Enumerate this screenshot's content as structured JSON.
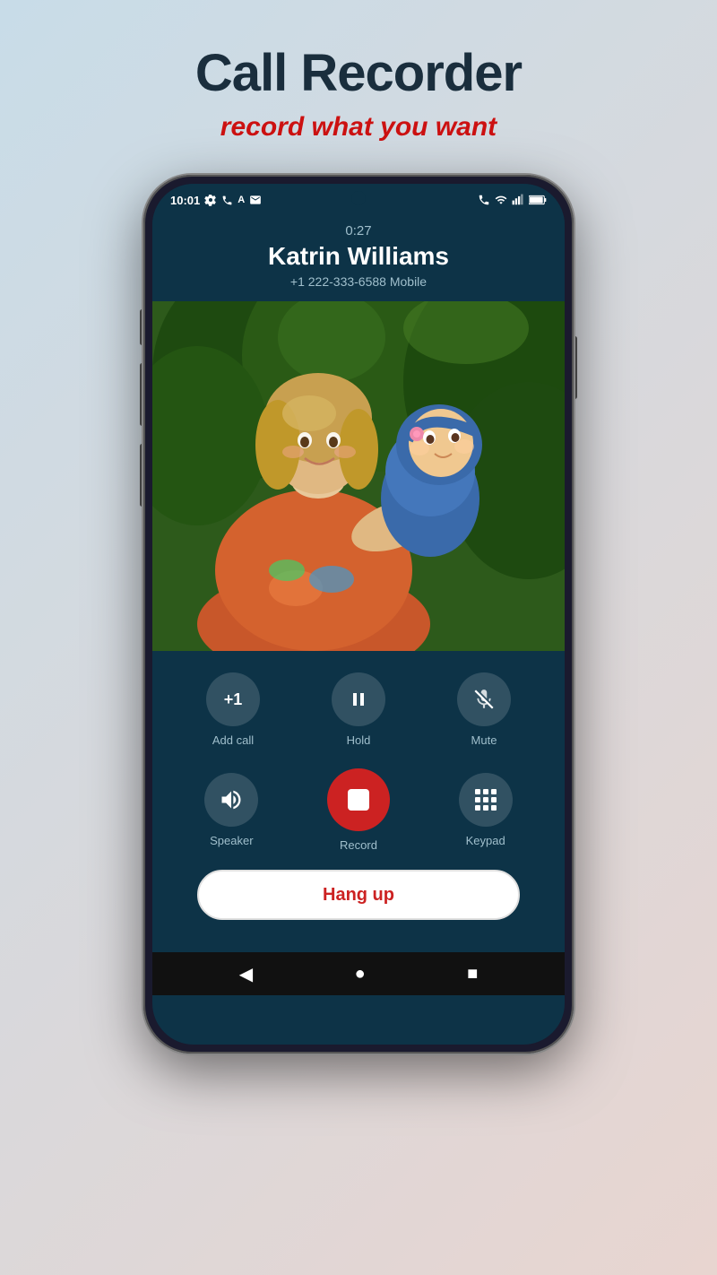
{
  "page": {
    "title": "Call Recorder",
    "subtitle": "record what you want",
    "background": {
      "from": "#c8dce8",
      "to": "#e8d5d0"
    }
  },
  "phone": {
    "status_bar": {
      "time": "10:01",
      "left_icons": [
        "gear",
        "phone",
        "A",
        "mail"
      ],
      "right_icons": [
        "call-record",
        "wifi",
        "signal",
        "battery"
      ]
    },
    "call": {
      "duration": "0:27",
      "caller_name": "Katrin Williams",
      "caller_number": "+1 222-333-6588 Mobile"
    },
    "controls": {
      "row1": [
        {
          "id": "add-call",
          "label": "Add call",
          "icon": "+1"
        },
        {
          "id": "hold",
          "label": "Hold",
          "icon": "⏸"
        },
        {
          "id": "mute",
          "label": "Mute",
          "icon": "🎤"
        }
      ],
      "row2": [
        {
          "id": "speaker",
          "label": "Speaker",
          "icon": "🔊"
        },
        {
          "id": "record",
          "label": "Record",
          "icon": "⏹"
        },
        {
          "id": "keypad",
          "label": "Keypad",
          "icon": "grid"
        }
      ]
    },
    "hang_up_label": "Hang up",
    "nav": {
      "back": "◀",
      "home": "●",
      "recents": "■"
    }
  }
}
